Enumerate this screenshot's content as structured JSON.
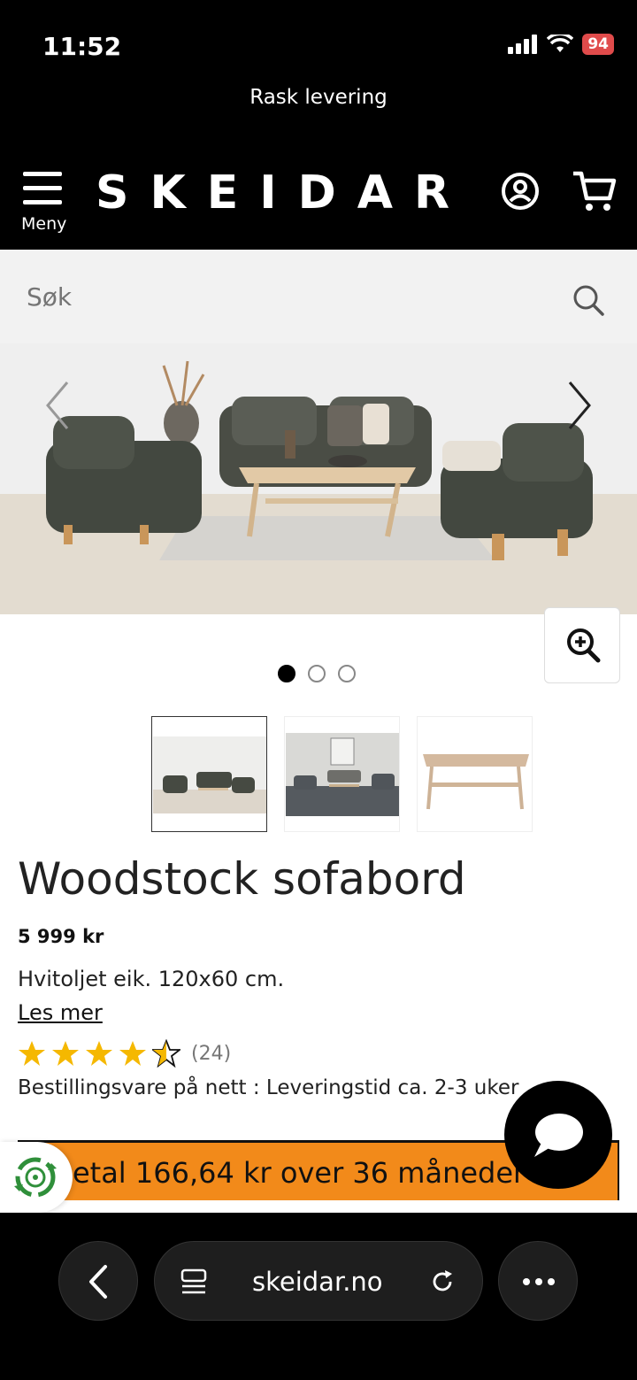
{
  "status_bar": {
    "time": "11:52",
    "battery": "94"
  },
  "promo": {
    "text": "Rask levering"
  },
  "header": {
    "menu_label": "Meny",
    "logo": "SKEIDAR"
  },
  "search": {
    "placeholder": "Søk"
  },
  "carousel": {
    "image_count": 3,
    "active_index": 0
  },
  "product": {
    "title": "Woodstock sofabord",
    "price": "5 999 kr",
    "description": "Hvitoljet eik. 120x60 cm.",
    "read_more": "Les mer",
    "rating": 4.5,
    "review_count": "(24)",
    "availability": "Bestillingsvare på nett : Leveringstid ca. 2-3 uker"
  },
  "finance": {
    "text": "Betal 166,64 kr over 36 måneder"
  },
  "browser": {
    "url": "skeidar.no"
  },
  "colors": {
    "accent_orange": "#f28a1a",
    "star_yellow": "#f5b800",
    "header_black": "#000000"
  },
  "icons": [
    "menu-icon",
    "account-icon",
    "cart-icon",
    "search-icon",
    "chevron-left-icon",
    "chevron-right-icon",
    "zoom-in-icon",
    "star-icon",
    "recycle-icon",
    "chat-icon",
    "back-icon",
    "tabs-icon",
    "reload-icon",
    "more-icon"
  ]
}
